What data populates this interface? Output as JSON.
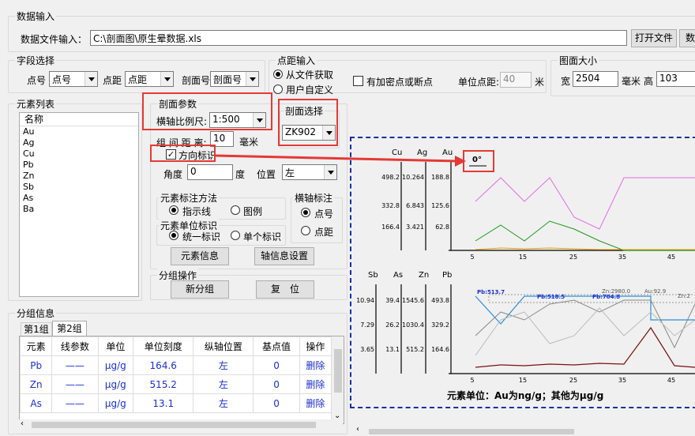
{
  "data_input": {
    "group_title": "数据输入",
    "file_label": "数据文件输入：",
    "file_path": "C:\\剖面图\\原生晕数据.xls",
    "open_button": "打开文件",
    "data_button": "数据"
  },
  "field_select": {
    "group_title": "字段选择",
    "point_label": "点号",
    "point_value": "点号",
    "distance_label": "点距",
    "distance_value": "点距",
    "section_label": "剖面号",
    "section_value": "剖面号"
  },
  "spacing": {
    "group_title": "点距输入",
    "from_file": "从文件获取",
    "custom": "用户自定义",
    "encrypt_label": "有加密点或断点",
    "unit_label": "单位点距:",
    "unit_value": "40",
    "unit_suffix": "米"
  },
  "figure_size": {
    "group_title": "图面大小",
    "width_label": "宽",
    "width_value": "2504",
    "mm_label": "毫米",
    "height_label": "高",
    "height_value": "103"
  },
  "element_list": {
    "group_title": "元素列表",
    "column": "名称",
    "items": [
      "Au",
      "Ag",
      "Cu",
      "Pb",
      "Zn",
      "Sb",
      "As",
      "Ba"
    ]
  },
  "section_params": {
    "group_title": "剖面参数",
    "scale_label": "横轴比例尺:",
    "scale_value": "1:500",
    "group_spacing_label": "组 间 距 离:",
    "group_spacing_value": "10",
    "group_spacing_unit": "毫米",
    "direction_label": "方向标识",
    "angle_label": "角度",
    "angle_value": "0",
    "angle_unit": "度",
    "position_label": "位置",
    "position_value": "左"
  },
  "section_select": {
    "group_title": "剖面选择",
    "value": "ZK902"
  },
  "label_method": {
    "group_title": "元素标注方法",
    "opt1": "指示线",
    "opt2": "图例"
  },
  "unit_mark": {
    "group_title": "元素单位标识",
    "opt1": "统一标识",
    "opt2": "单个标识"
  },
  "axis_label": {
    "group_title": "横轴标注",
    "opt1": "点号",
    "opt2": "点距"
  },
  "buttons": {
    "element_info": "元素信息",
    "axis_settings": "轴信息设置",
    "new_group": "新分组",
    "reset": "复　位"
  },
  "group_ops": {
    "group_title": "分组操作"
  },
  "group_info": {
    "group_title": "分组信息",
    "tabs": [
      "第1组",
      "第2组"
    ],
    "columns": [
      "元素",
      "线参数",
      "单位",
      "单位刻度",
      "纵轴位置",
      "基点值",
      "操作"
    ],
    "rows": [
      {
        "element": "Pb",
        "line": "——",
        "unit": "μg/g",
        "scale": "164.6",
        "pos": "左",
        "base": "0",
        "op": "删除"
      },
      {
        "element": "Zn",
        "line": "——",
        "unit": "μg/g",
        "scale": "515.2",
        "pos": "左",
        "base": "0",
        "op": "删除"
      },
      {
        "element": "As",
        "line": "——",
        "unit": "μg/g",
        "scale": "13.1",
        "pos": "左",
        "base": "0",
        "op": "删除"
      }
    ]
  },
  "preview": {
    "north_mark": "0°",
    "top_headers": [
      "Cu",
      "Ag",
      "Au"
    ],
    "top_ticks": {
      "cu": [
        "498.2",
        "332.8",
        "166.4"
      ],
      "ag": [
        "10.264",
        "6.843",
        "3.421"
      ],
      "au": [
        "188.8",
        "125.6",
        "62.8"
      ]
    },
    "bottom_headers": [
      "Sb",
      "As",
      "Zn",
      "Pb"
    ],
    "bottom_ticks": {
      "sb": [
        "10.94",
        "7.29",
        "3.65"
      ],
      "as": [
        "39.4",
        "26.2",
        "13.1"
      ],
      "zn": [
        "1545.6",
        "1030.4",
        "515.2"
      ],
      "pb": [
        "493.8",
        "329.2",
        "164.6"
      ]
    },
    "x_ticks": [
      "5",
      "15",
      "25",
      "35",
      "45"
    ],
    "line_labels": [
      "Pb:513.7",
      "Pb:518.5",
      "Pb:704.8",
      "Zn:2980.0",
      "Au:92.9",
      "Zn:2"
    ],
    "footer": "元素单位：Au为ng/g；其他为μg/g",
    "colors": {
      "au": "#e26be6",
      "cu": "#1a9a1a",
      "ag": "#e8a000",
      "pb": "#7b1010",
      "zn": "#888888",
      "as": "#2a8fd8",
      "sb": "#bbbbbb"
    }
  }
}
